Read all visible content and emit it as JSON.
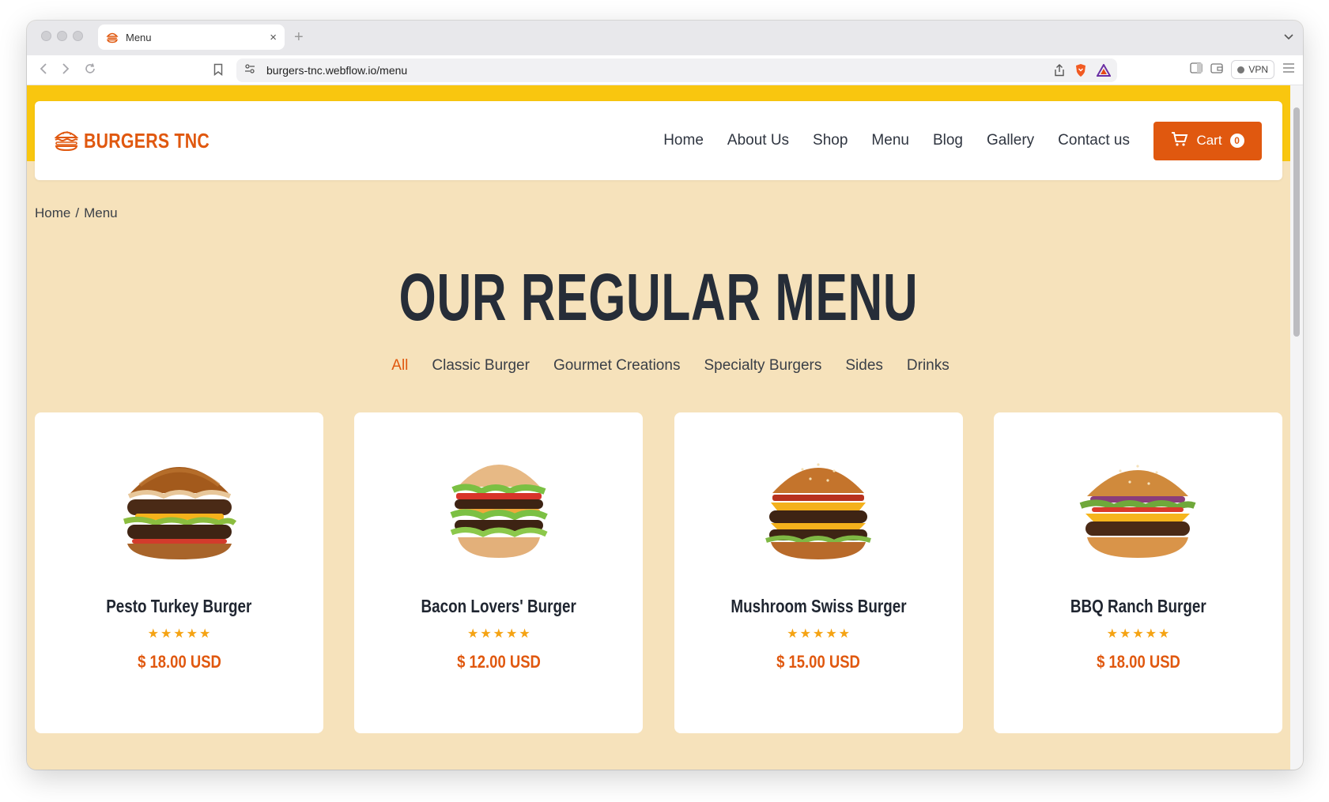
{
  "browser": {
    "tab_title": "Menu",
    "tab_close": "×",
    "new_tab": "+",
    "url": "burgers-tnc.webflow.io/menu",
    "vpn_label": "VPN"
  },
  "site": {
    "brand": "BURGERS TNC",
    "nav": [
      "Home",
      "About Us",
      "Shop",
      "Menu",
      "Blog",
      "Gallery",
      "Contact us"
    ],
    "cart_label": "Cart",
    "cart_count": "0",
    "accent_color": "#e0580f",
    "banner_color": "#f9c60f",
    "page_bg": "#f6e2bb"
  },
  "breadcrumb": {
    "home": "Home",
    "separator": "/",
    "current": "Menu"
  },
  "headline": "OUR REGULAR MENU",
  "filters": {
    "active": "All",
    "items": [
      "All",
      "Classic Burger",
      "Gourmet Creations",
      "Specialty Burgers",
      "Sides",
      "Drinks"
    ]
  },
  "products": [
    {
      "name": "Pesto Turkey Burger",
      "price": "$ 18.00 USD",
      "rating": 5
    },
    {
      "name": "Bacon Lovers' Burger",
      "price": "$ 12.00 USD",
      "rating": 5
    },
    {
      "name": "Mushroom Swiss Burger",
      "price": "$ 15.00 USD",
      "rating": 5
    },
    {
      "name": "BBQ Ranch Burger",
      "price": "$ 18.00 USD",
      "rating": 5
    }
  ]
}
